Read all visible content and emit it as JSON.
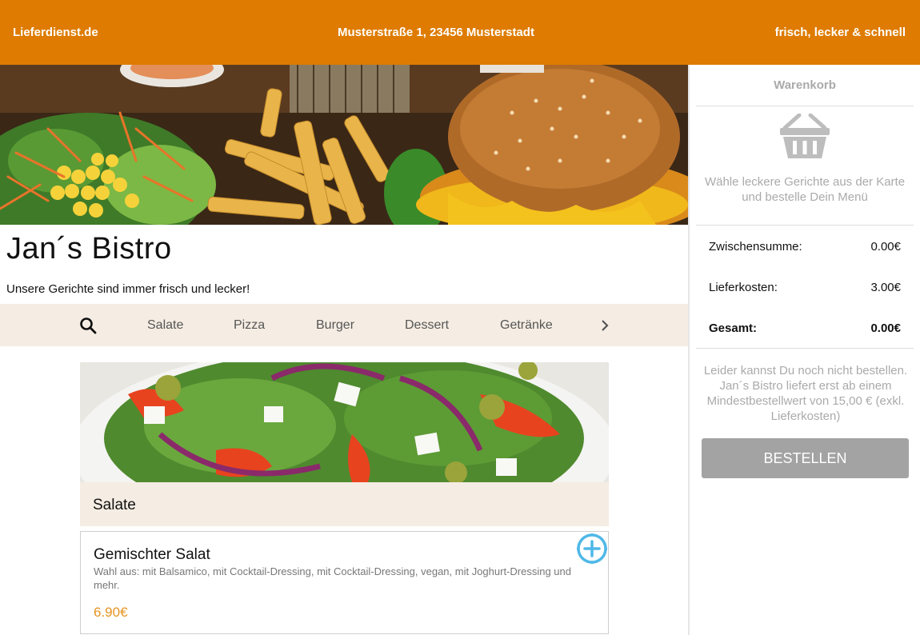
{
  "topbar": {
    "site": "Lieferdienst.de",
    "address": "Musterstraße 1, 23456 Musterstadt",
    "slogan": "frisch, lecker & schnell"
  },
  "restaurant": {
    "name": "Jan´s Bistro",
    "tagline": "Unsere Gerichte sind immer frisch und lecker!"
  },
  "categories": [
    "Salate",
    "Pizza",
    "Burger",
    "Dessert",
    "Getränke"
  ],
  "icons": {
    "search": "search-icon",
    "next": "chevron-right-icon",
    "add": "plus-circle-icon",
    "basket": "basket-icon"
  },
  "section": {
    "title": "Salate"
  },
  "item": {
    "name": "Gemischter Salat",
    "description": "Wahl aus: mit Balsamico, mit Cocktail-Dressing, mit Cocktail-Dressing, vegan, mit Joghurt-Dressing und mehr.",
    "price": "6.90€"
  },
  "cart": {
    "title": "Warenkorb",
    "empty_text": "Wähle leckere Gerichte aus der Karte und bestelle Dein Menü",
    "subtotal_label": "Zwischensumme:",
    "subtotal_value": "0.00€",
    "delivery_label": "Lieferkosten:",
    "delivery_value": "3.00€",
    "total_label": "Gesamt:",
    "total_value": "0.00€",
    "note": "Leider kannst Du noch nicht bestellen. Jan´s Bistro liefert erst ab einem Mindestbestellwert von 15,00 € (exkl. Lieferkosten)",
    "order_button": "BESTELLEN"
  },
  "colors": {
    "brand": "#de7b00",
    "price": "#e7931f",
    "nav_bg": "#f5ede3",
    "add_icon": "#4fb8e8",
    "button_disabled": "#a3a3a3"
  }
}
